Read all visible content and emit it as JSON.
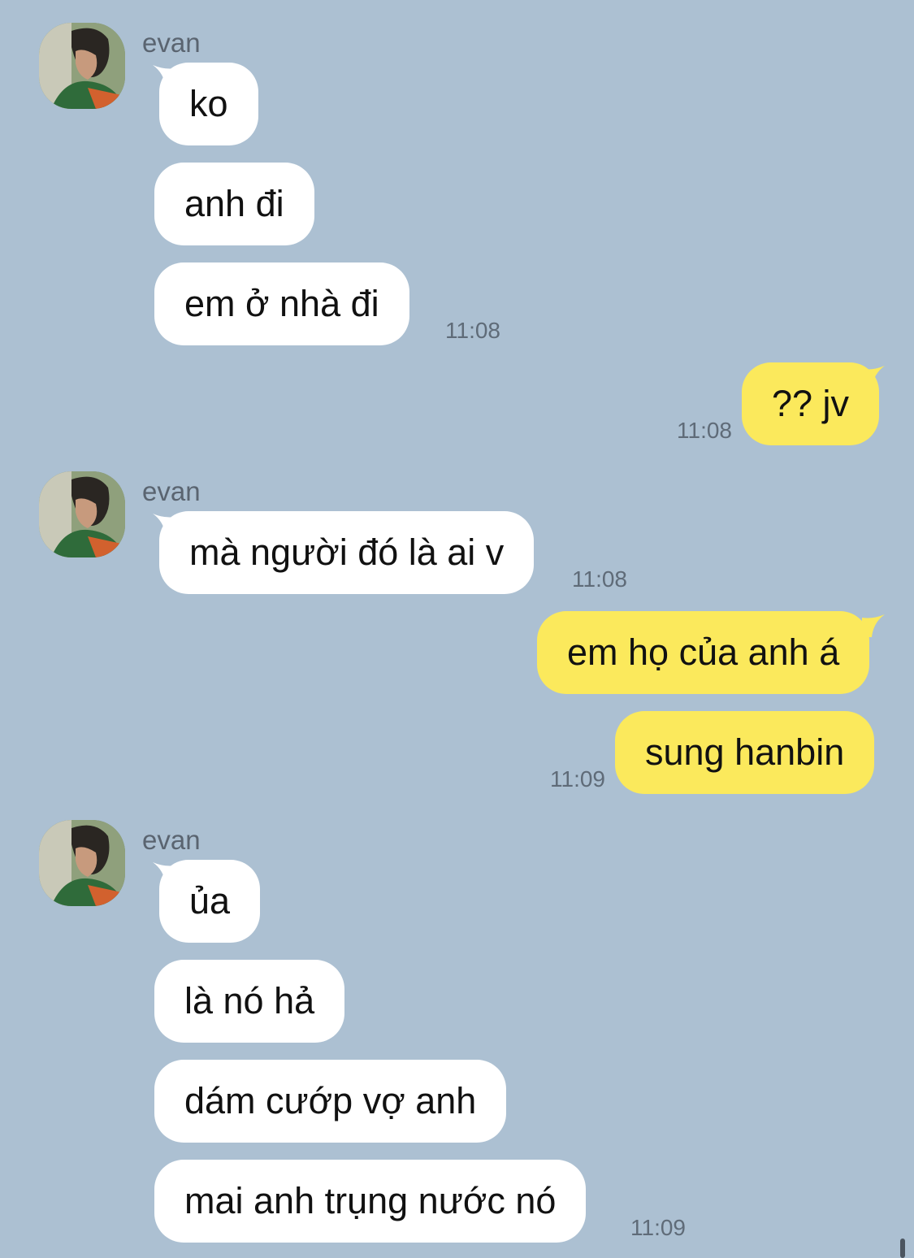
{
  "colors": {
    "background": "#acc0d2",
    "incoming_bubble": "#ffffff",
    "outgoing_bubble": "#fbe95c",
    "timestamp": "#5f6b78"
  },
  "groups": [
    {
      "sender": "evan",
      "avatar_icon": "profile-photo",
      "messages": [
        "ko",
        "anh đi",
        "em ở nhà đi"
      ],
      "time": "11:08"
    },
    {
      "outgoing": true,
      "messages": [
        "?? jv"
      ],
      "time": "11:08"
    },
    {
      "sender": "evan",
      "avatar_icon": "profile-photo",
      "messages": [
        "mà người đó là ai v"
      ],
      "time": "11:08"
    },
    {
      "outgoing": true,
      "messages": [
        "em họ của anh á",
        "sung hanbin"
      ],
      "time": "11:09"
    },
    {
      "sender": "evan",
      "avatar_icon": "profile-photo",
      "messages": [
        "ủa",
        "là nó hả",
        "dám cướp vợ anh",
        "mai anh trụng nước nó"
      ],
      "time": "11:09"
    }
  ]
}
